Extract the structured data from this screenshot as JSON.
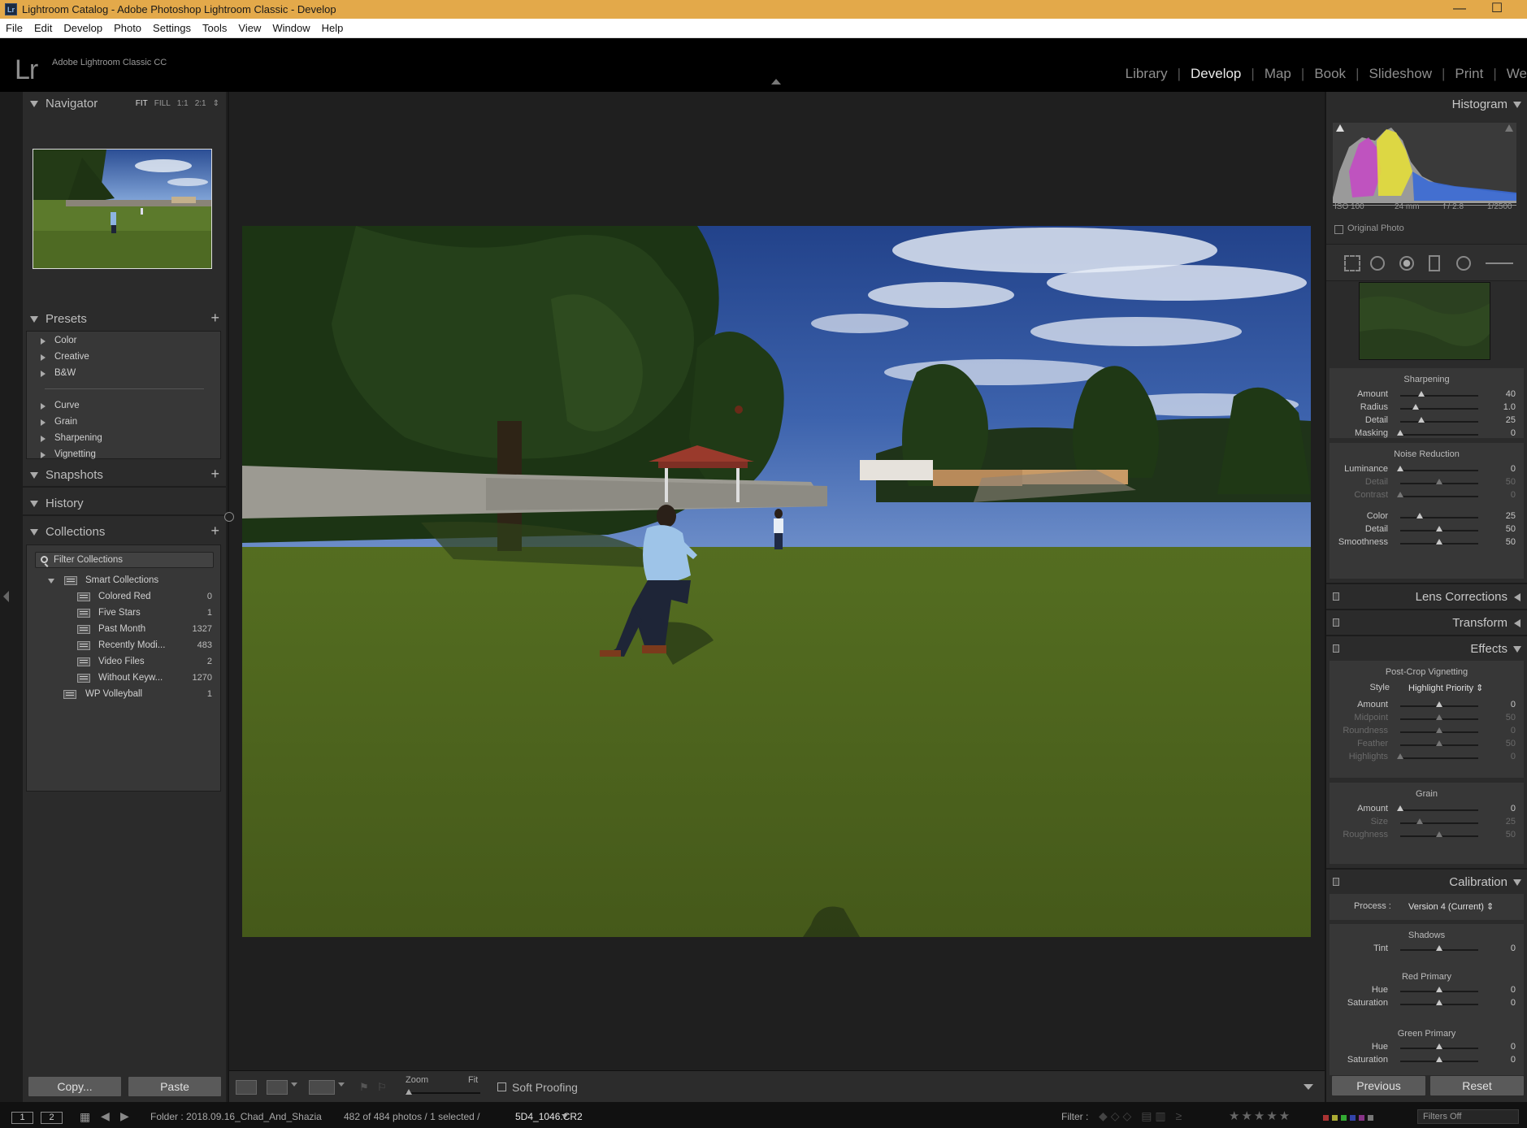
{
  "window": {
    "title": "Lightroom Catalog - Adobe Photoshop Lightroom Classic - Develop",
    "app_icon": "Lr",
    "minimize": "—",
    "maximize": "☐",
    "close": "✕"
  },
  "menu": [
    "File",
    "Edit",
    "Develop",
    "Photo",
    "Settings",
    "Tools",
    "View",
    "Window",
    "Help"
  ],
  "identity": {
    "logo": "Lr",
    "product_name": "Adobe Lightroom Classic CC",
    "modules": [
      "Library",
      "Develop",
      "Map",
      "Book",
      "Slideshow",
      "Print",
      "We"
    ],
    "active_module": "Develop"
  },
  "navigator": {
    "title": "Navigator",
    "options": [
      "FIT",
      "FILL",
      "1:1",
      "2:1"
    ],
    "active_option": "FIT"
  },
  "presets": {
    "title": "Presets",
    "groups_a": [
      "Color",
      "Creative",
      "B&W"
    ],
    "groups_b": [
      "Curve",
      "Grain",
      "Sharpening",
      "Vignetting"
    ]
  },
  "snapshots": {
    "title": "Snapshots"
  },
  "history": {
    "title": "History"
  },
  "collections": {
    "title": "Collections",
    "filter_label": "Filter Collections",
    "smart_set": "Smart Collections",
    "items": [
      {
        "name": "Colored Red",
        "count": "0"
      },
      {
        "name": "Five Stars",
        "count": "1"
      },
      {
        "name": "Past Month",
        "count": "1327"
      },
      {
        "name": "Recently Modi...",
        "count": "483"
      },
      {
        "name": "Video Files",
        "count": "2"
      },
      {
        "name": "Without Keyw...",
        "count": "1270"
      }
    ],
    "extra": {
      "name": "WP Volleyball",
      "count": "1"
    }
  },
  "left_buttons": {
    "copy": "Copy...",
    "paste": "Paste"
  },
  "toolbar": {
    "zoom_label": "Zoom",
    "fit_label": "Fit",
    "soft_proofing": "Soft Proofing"
  },
  "histogram": {
    "title": "Histogram",
    "iso": "ISO 100",
    "focal": "24 mm",
    "aperture": "f / 2.8",
    "shutter": "1/2500",
    "original_photo": "Original Photo"
  },
  "detail": {
    "sharpening": {
      "title": "Sharpening",
      "sliders": [
        {
          "name": "Amount",
          "value": "40",
          "pos": 0.27
        },
        {
          "name": "Radius",
          "value": "1.0",
          "pos": 0.2
        },
        {
          "name": "Detail",
          "value": "25",
          "pos": 0.27
        },
        {
          "name": "Masking",
          "value": "0",
          "pos": 0.0
        }
      ]
    },
    "noise": {
      "title": "Noise Reduction",
      "sliders": [
        {
          "name": "Luminance",
          "value": "0",
          "pos": 0.0,
          "dim": false
        },
        {
          "name": "Detail",
          "value": "50",
          "pos": 0.5,
          "dim": true
        },
        {
          "name": "Contrast",
          "value": "0",
          "pos": 0.0,
          "dim": true
        },
        {
          "name": "Color",
          "value": "25",
          "pos": 0.25,
          "dim": false
        },
        {
          "name": "Detail",
          "value": "50",
          "pos": 0.5,
          "dim": false
        },
        {
          "name": "Smoothness",
          "value": "50",
          "pos": 0.5,
          "dim": false
        }
      ]
    }
  },
  "lens_corrections": {
    "title": "Lens Corrections"
  },
  "transform": {
    "title": "Transform"
  },
  "effects": {
    "title": "Effects",
    "vignette_title": "Post-Crop Vignetting",
    "style_label": "Style",
    "style_value": "Highlight Priority ⇕",
    "vignette_sliders": [
      {
        "name": "Amount",
        "value": "0",
        "pos": 0.5,
        "dim": false
      },
      {
        "name": "Midpoint",
        "value": "50",
        "pos": 0.5,
        "dim": true
      },
      {
        "name": "Roundness",
        "value": "0",
        "pos": 0.5,
        "dim": true
      },
      {
        "name": "Feather",
        "value": "50",
        "pos": 0.5,
        "dim": true
      },
      {
        "name": "Highlights",
        "value": "0",
        "pos": 0.0,
        "dim": true
      }
    ],
    "grain_title": "Grain",
    "grain_sliders": [
      {
        "name": "Amount",
        "value": "0",
        "pos": 0.0,
        "dim": false
      },
      {
        "name": "Size",
        "value": "25",
        "pos": 0.25,
        "dim": true
      },
      {
        "name": "Roughness",
        "value": "50",
        "pos": 0.5,
        "dim": true
      }
    ]
  },
  "calibration": {
    "title": "Calibration",
    "process_label": "Process :",
    "process_value": "Version 4 (Current) ⇕",
    "shadows_title": "Shadows",
    "shadows": [
      {
        "name": "Tint",
        "value": "0",
        "pos": 0.5
      }
    ],
    "red_title": "Red Primary",
    "red": [
      {
        "name": "Hue",
        "value": "0",
        "pos": 0.5
      },
      {
        "name": "Saturation",
        "value": "0",
        "pos": 0.5
      }
    ],
    "green_title": "Green Primary",
    "green": [
      {
        "name": "Hue",
        "value": "0",
        "pos": 0.5
      },
      {
        "name": "Saturation",
        "value": "0",
        "pos": 0.5
      }
    ]
  },
  "right_buttons": {
    "previous": "Previous",
    "reset": "Reset"
  },
  "filmstrip": {
    "screen1": "1",
    "screen2": "2",
    "folder": "Folder : 2018.09.16_Chad_And_Shazia",
    "count": "482 of 484 photos / 1 selected /",
    "filename": "5D4_1046.CR2",
    "filter_label": "Filter :",
    "filters_off": "Filters Off"
  }
}
